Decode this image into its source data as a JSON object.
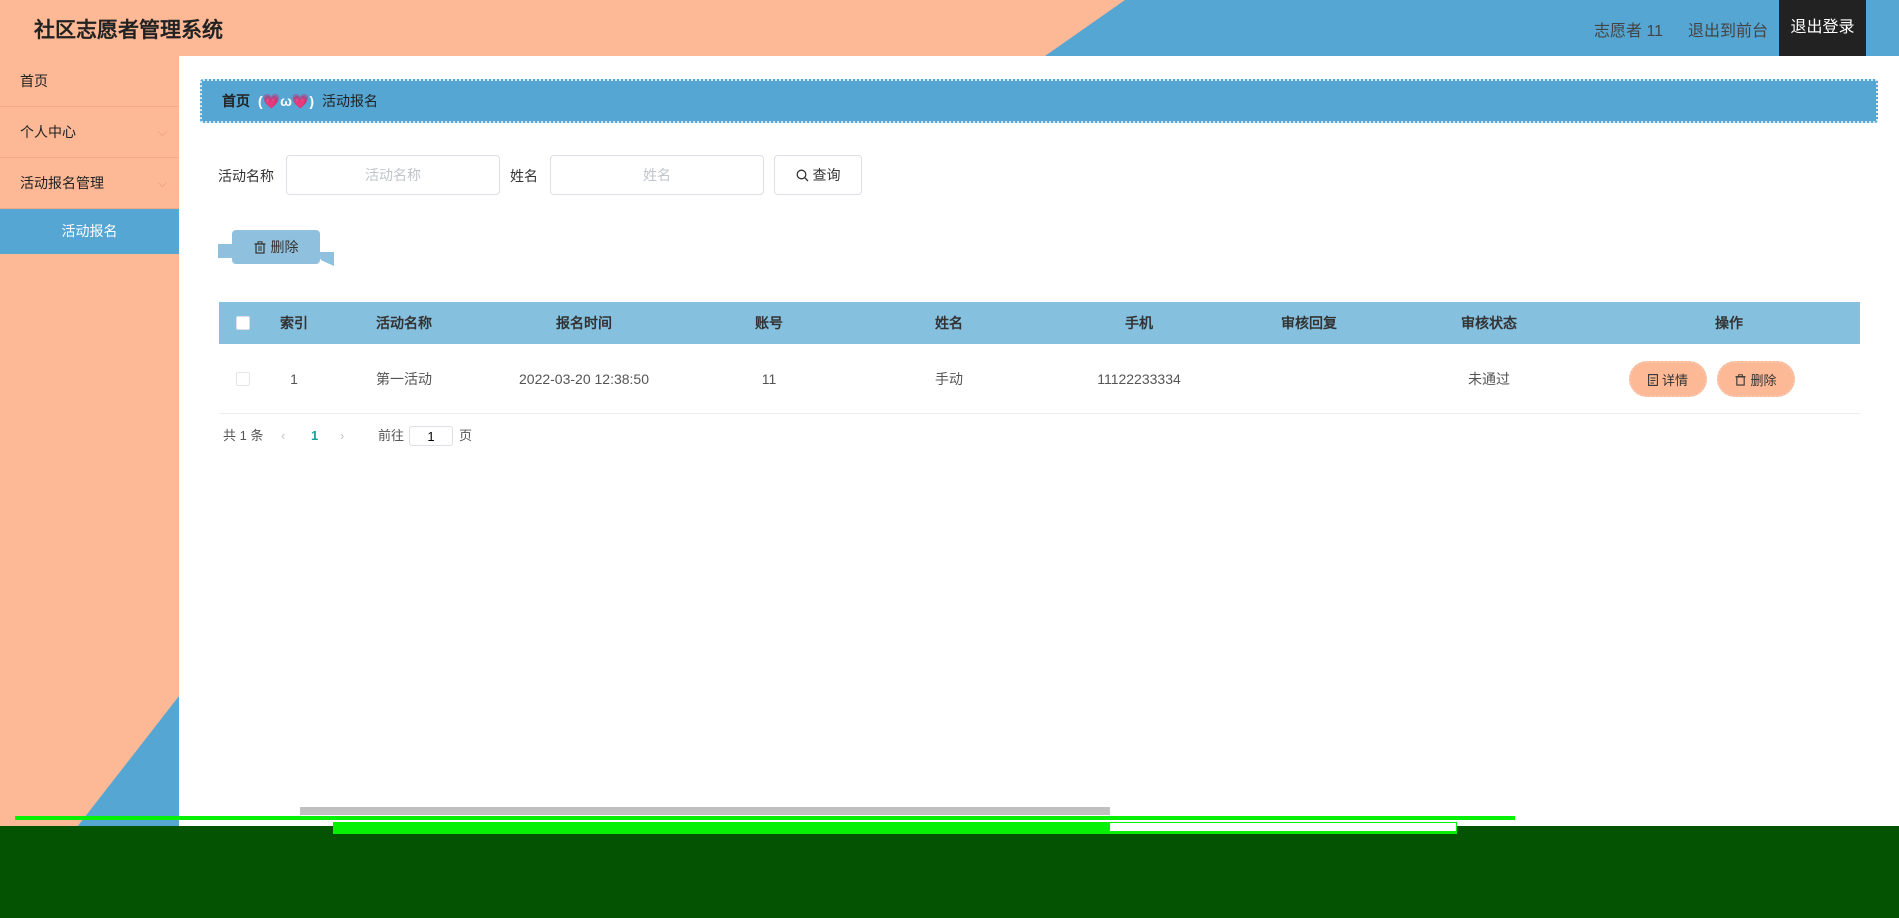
{
  "header": {
    "title": "社区志愿者管理系统",
    "user": "志愿者 11",
    "front_link": "退出到前台",
    "logout": "退出登录"
  },
  "sidebar": {
    "items": [
      {
        "label": "首页"
      },
      {
        "label": "个人中心"
      },
      {
        "label": "活动报名管理"
      },
      {
        "label": "活动报名"
      }
    ],
    "chevron": "⌵"
  },
  "breadcrumb": {
    "home": "首页",
    "separator": "(💗ω💗)",
    "current": "活动报名"
  },
  "search": {
    "activity_label": "活动名称",
    "activity_placeholder": "活动名称",
    "name_label": "姓名",
    "name_placeholder": "姓名",
    "query_button": "查询"
  },
  "toolbar": {
    "delete_button": "删除"
  },
  "table": {
    "headers": [
      "索引",
      "活动名称",
      "报名时间",
      "账号",
      "姓名",
      "手机",
      "审核回复",
      "审核状态",
      "操作"
    ],
    "rows": [
      {
        "index": "1",
        "activity": "第一活动",
        "time": "2022-03-20 12:38:50",
        "account": "11",
        "name": "手动",
        "phone": "11122233334",
        "reply": "",
        "status": "未通过",
        "detail_btn": "详情",
        "delete_btn": "删除"
      }
    ]
  },
  "pagination": {
    "total": "共 1 条",
    "current_page": "1",
    "goto_label": "前往",
    "goto_value": "1",
    "page_suffix": "页"
  },
  "colors": {
    "peach": "#fdb896",
    "blue": "#55a6d3",
    "table_header": "#86c0df"
  }
}
